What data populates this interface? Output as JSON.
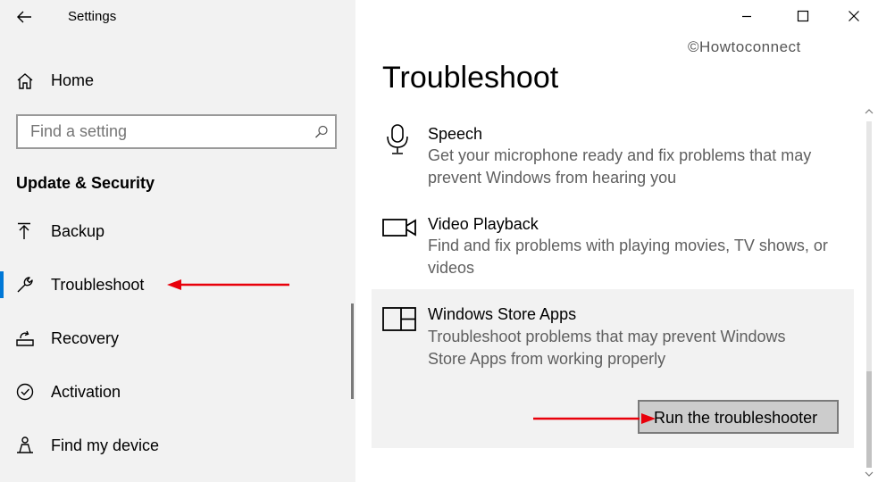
{
  "window": {
    "title": "Settings",
    "back_icon": "back-arrow-icon",
    "controls": [
      "minimize-icon",
      "maximize-icon",
      "close-icon"
    ]
  },
  "watermark": "©Howtoconnect",
  "sidebar": {
    "home_label": "Home",
    "search": {
      "placeholder": "Find a setting",
      "value": ""
    },
    "section_title": "Update & Security",
    "items": [
      {
        "label": "Backup",
        "icon": "backup-arrow-icon",
        "selected": false
      },
      {
        "label": "Troubleshoot",
        "icon": "wrench-icon",
        "selected": true
      },
      {
        "label": "Recovery",
        "icon": "recovery-icon",
        "selected": false
      },
      {
        "label": "Activation",
        "icon": "check-circle-icon",
        "selected": false
      },
      {
        "label": "Find my device",
        "icon": "person-location-icon",
        "selected": false
      }
    ]
  },
  "main": {
    "title": "Troubleshoot",
    "items": [
      {
        "title": "Speech",
        "desc_lines": [
          "Get your microphone ready and fix problems that may",
          "prevent Windows from hearing you"
        ],
        "icon": "microphone-icon"
      },
      {
        "title": "Video Playback",
        "desc_lines": [
          "Find and fix problems with playing movies, TV shows, or",
          "videos"
        ],
        "icon": "video-camera-icon"
      },
      {
        "title": "Windows Store Apps",
        "desc_lines": [
          "Troubleshoot problems that may prevent Windows",
          "Store Apps from working properly"
        ],
        "icon": "store-apps-icon",
        "expanded": true
      }
    ],
    "run_button_label": "Run the troubleshooter"
  },
  "colors": {
    "sidebar_bg": "#f2f2f2",
    "selection_accent": "#0078d7",
    "annotation_arrow": "#e8000b",
    "selected_item_bg": "#f2f2f2",
    "button_bg": "#cccccc"
  }
}
